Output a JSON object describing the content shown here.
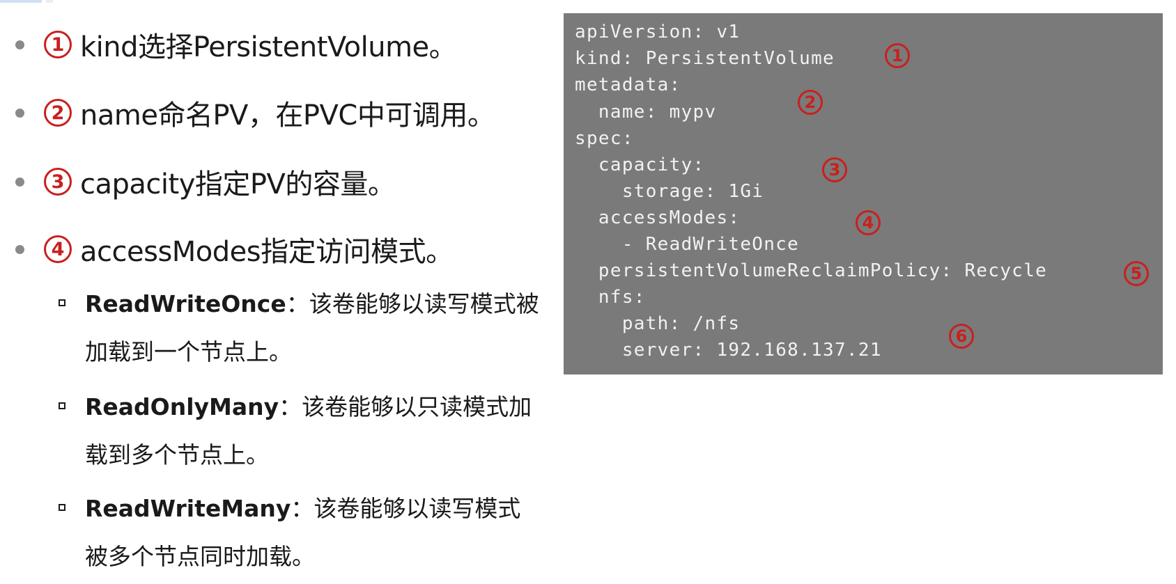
{
  "bullets": [
    {
      "num": "1",
      "text": "kind选择PersistentVolume。"
    },
    {
      "num": "2",
      "text": "name命名PV，在PVC中可调用。"
    },
    {
      "num": "3",
      "text": "capacity指定PV的容量。"
    },
    {
      "num": "4",
      "text": "accessModes指定访问模式。"
    }
  ],
  "access_modes": [
    {
      "term": "ReadWriteOnce",
      "desc_line1": "：该卷能够以读写模式被",
      "desc_line2": "加载到一个节点上。"
    },
    {
      "term": "ReadOnlyMany",
      "desc_line1": "：该卷能够以只读模式加",
      "desc_line2": "载到多个节点上。"
    },
    {
      "term": "ReadWriteMany",
      "desc_line1": "：该卷能够以读写模式",
      "desc_line2": "被多个节点同时加载。"
    }
  ],
  "code": {
    "lines": [
      "apiVersion: v1",
      "kind: PersistentVolume",
      "metadata:",
      "  name: mypv",
      "spec:",
      "  capacity:",
      "    storage: 1Gi",
      "  accessModes:",
      "    - ReadWriteOnce",
      "  persistentVolumeReclaimPolicy: Recycle",
      "  nfs:",
      "    path: /nfs",
      "    server: 192.168.137.21"
    ],
    "markers": [
      "1",
      "2",
      "3",
      "4",
      "5",
      "6"
    ]
  },
  "colors": {
    "accent": "#c8201e",
    "code_bg": "#7a7a7a",
    "code_text": "#f2f2f2",
    "bullet": "#8a8a8a"
  }
}
